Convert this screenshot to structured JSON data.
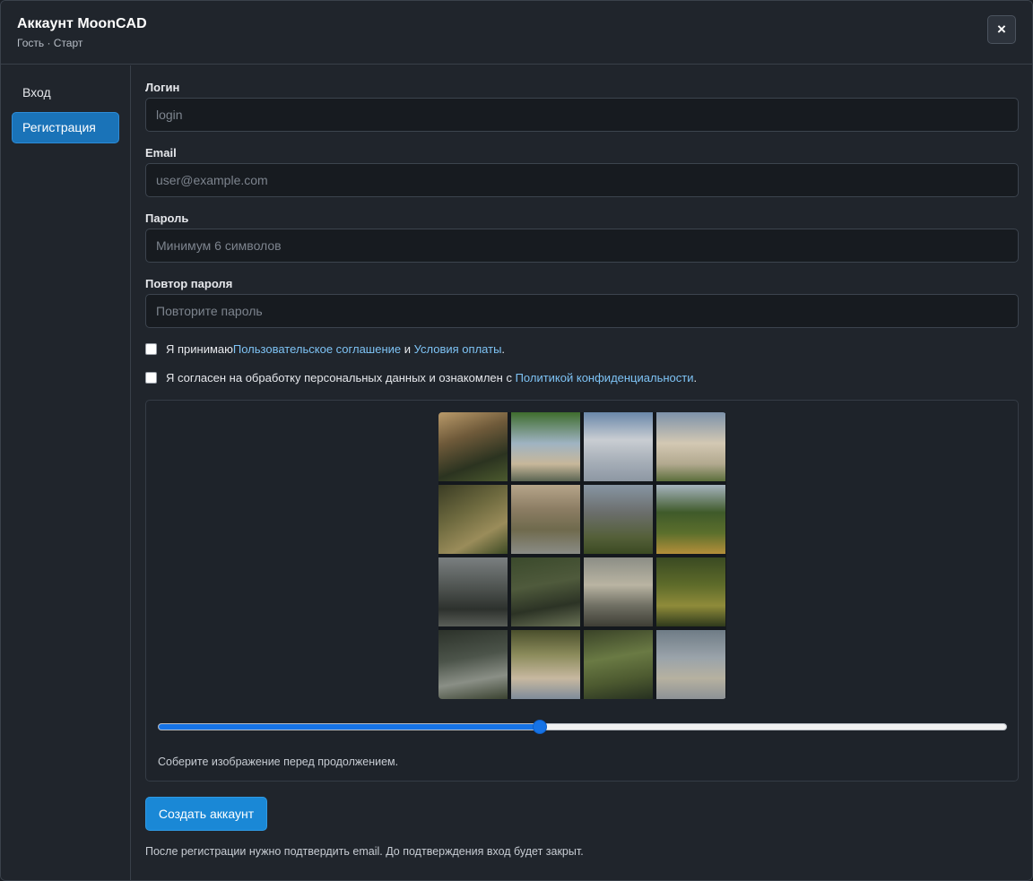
{
  "header": {
    "title": "Аккаунт MoonCAD",
    "subtitle": "Гость · Старт",
    "close_label": "×"
  },
  "sidebar": {
    "items": [
      {
        "label": "Вход",
        "active": false
      },
      {
        "label": "Регистрация",
        "active": true
      }
    ]
  },
  "form": {
    "login": {
      "label": "Логин",
      "placeholder": "login",
      "value": ""
    },
    "email": {
      "label": "Email",
      "placeholder": "user@example.com",
      "value": ""
    },
    "password": {
      "label": "Пароль",
      "placeholder": "Минимум 6 символов",
      "value": ""
    },
    "password_repeat": {
      "label": "Повтор пароля",
      "placeholder": "Повторите пароль",
      "value": ""
    },
    "terms": {
      "checked": false,
      "text_before": "Я принимаю ",
      "link1": "Пользовательское соглашение",
      "text_middle": " и ",
      "link2": "Условия оплаты",
      "text_after": "."
    },
    "privacy": {
      "checked": false,
      "text_before": "Я согласен на обработку персональных данных и ознакомлен с ",
      "link": "Политикой конфиденциальности",
      "text_after": "."
    },
    "captcha": {
      "image": "mountain-lake-forest-landscape",
      "grid": "4x4",
      "slider_value": 0.45,
      "hint": "Соберите изображение перед продолжением."
    },
    "submit_label": "Создать аккаунт",
    "note": "После регистрации нужно подтвердить email. До подтверждения вход будет закрыт."
  },
  "colors": {
    "background": "#20252c",
    "accent": "#1a88d6",
    "sidebar_active": "#1a73b8",
    "link": "#7ec3f5",
    "slider": "#1673e6"
  }
}
